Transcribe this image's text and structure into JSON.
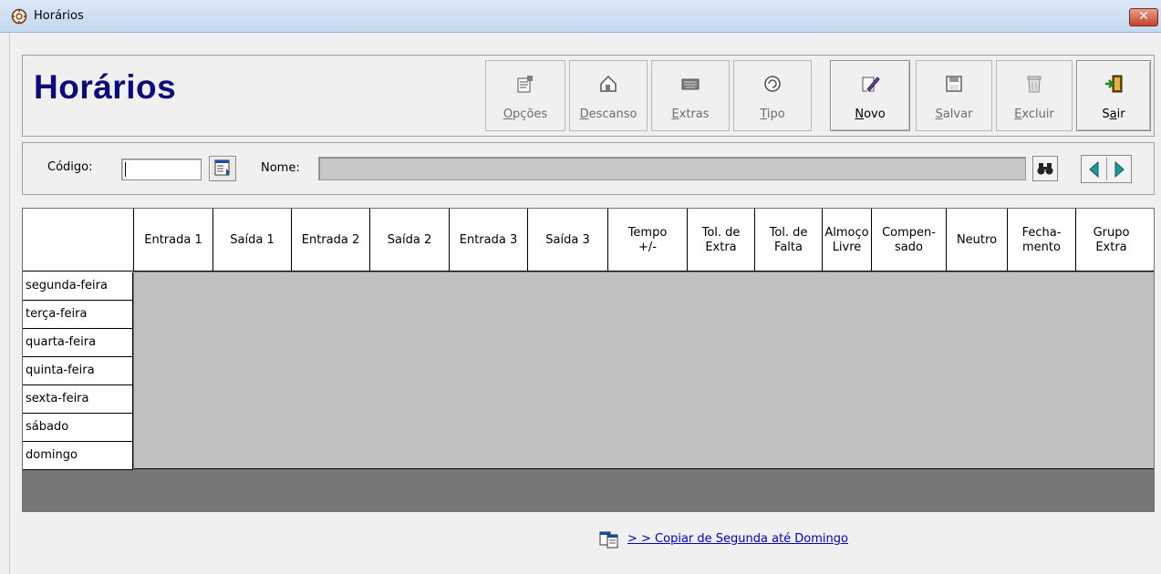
{
  "window": {
    "title": "Horários",
    "close_symbol": "✕"
  },
  "header": {
    "title": "Horários",
    "toolbar": [
      {
        "id": "opcoes",
        "label_pre": "",
        "label_ul": "O",
        "label_post": "pções",
        "icon": "options-icon",
        "enabled": false
      },
      {
        "id": "descanso",
        "label_pre": "",
        "label_ul": "D",
        "label_post": "escanso",
        "icon": "house-icon",
        "enabled": false
      },
      {
        "id": "extras",
        "label_pre": "",
        "label_ul": "E",
        "label_post": "xtras",
        "icon": "keyboard-icon",
        "enabled": false
      },
      {
        "id": "tipo",
        "label_pre": "",
        "label_ul": "T",
        "label_post": "ipo",
        "icon": "tipo-icon",
        "enabled": false
      },
      {
        "id": "novo",
        "label_pre": "",
        "label_ul": "N",
        "label_post": "ovo",
        "icon": "pencil-icon",
        "enabled": true
      },
      {
        "id": "salvar",
        "label_pre": "",
        "label_ul": "S",
        "label_post": "alvar",
        "icon": "floppy-icon",
        "enabled": false
      },
      {
        "id": "excluir",
        "label_pre": "",
        "label_ul": "E",
        "label_post": "xcluir",
        "icon": "trash-icon",
        "enabled": false
      },
      {
        "id": "sair",
        "label_pre": "S",
        "label_ul": "a",
        "label_post": "ir",
        "icon": "exit-door-icon",
        "enabled": true
      }
    ]
  },
  "search": {
    "codigo_label": "Código:",
    "codigo_value": "",
    "nome_label": "Nome:",
    "nome_value": ""
  },
  "grid": {
    "columns": [
      "Entrada 1",
      "Saída 1",
      "Entrada 2",
      "Saída 2",
      "Entrada 3",
      "Saída 3",
      "Tempo\n+/-",
      "Tol. de\nExtra",
      "Tol. de\nFalta",
      "Almoço\nLivre",
      "Compen-\nsado",
      "Neutro",
      "Fecha-\nmento",
      "Grupo\nExtra"
    ],
    "rows": [
      "segunda-feira",
      "terça-feira",
      "quarta-feira",
      "quinta-feira",
      "sexta-feira",
      "sábado",
      "domingo"
    ]
  },
  "copy_link": {
    "text": "> > Copiar de Segunda até Domingo"
  },
  "colors": {
    "title": "#0a0a7a",
    "link": "#0000cc",
    "grid_empty": "#c0c0c0",
    "grid_footer": "#777777"
  }
}
